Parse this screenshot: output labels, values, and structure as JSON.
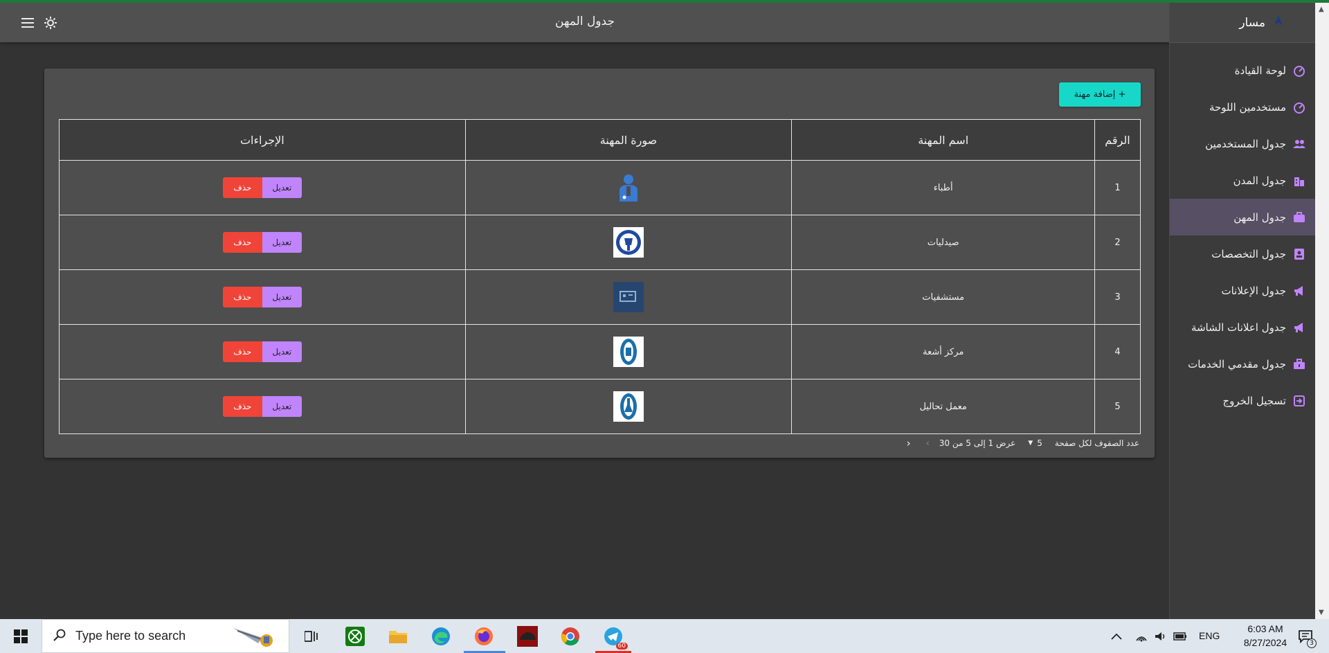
{
  "appbar": {
    "title": "جدول المهن"
  },
  "sidebar": {
    "brand": "مسار",
    "items": [
      {
        "label": "لوحة القيادة",
        "icon": "dashboard-icon",
        "active": false
      },
      {
        "label": "مستخدمين اللوحة",
        "icon": "dashboard-icon",
        "active": false
      },
      {
        "label": "جدول المستخدمين",
        "icon": "users-icon",
        "active": false
      },
      {
        "label": "جدول المدن",
        "icon": "city-icon",
        "active": false
      },
      {
        "label": "جدول المهن",
        "icon": "briefcase-icon",
        "active": true
      },
      {
        "label": "جدول التخصصات",
        "icon": "id-badge-icon",
        "active": false
      },
      {
        "label": "جدول الإعلانات",
        "icon": "megaphone-icon",
        "active": false
      },
      {
        "label": "جدول اعلانات الشاشة",
        "icon": "megaphone-icon",
        "active": false
      },
      {
        "label": "جدول مقدمي الخدمات",
        "icon": "toolbox-icon",
        "active": false
      },
      {
        "label": "تسجيل الخروج",
        "icon": "logout-icon",
        "active": false
      }
    ]
  },
  "main": {
    "add_button": "إضافة مهنة +",
    "columns": [
      "الرقم",
      "اسم المهنة",
      "صورة المهنة",
      "الإجراءات"
    ],
    "rows": [
      {
        "num": "1",
        "name": "أطباء",
        "image": "doctors-icon"
      },
      {
        "num": "2",
        "name": "صيدليات",
        "image": "pharmacy-icon"
      },
      {
        "num": "3",
        "name": "مستشفيات",
        "image": "hospital-icon"
      },
      {
        "num": "4",
        "name": "مركز أشعة",
        "image": "radiology-icon"
      },
      {
        "num": "5",
        "name": "معمل تحاليل",
        "image": "lab-icon"
      }
    ],
    "edit_label": "تعديل",
    "delete_label": "حذف",
    "pagination": {
      "rows_per_page_label": "عدد الصفوف لكل صفحة",
      "rows_per_page": "5",
      "range_text": "عرض 1 إلى 5 من 30"
    }
  },
  "taskbar": {
    "search_placeholder": "Type here to search",
    "language": "ENG",
    "time": "6:03 AM",
    "date": "8/27/2024",
    "notification_count": "3",
    "telegram_badge": "60"
  },
  "colors": {
    "accent_teal": "#17d8c8",
    "edit_purple": "#c084fc",
    "delete_red": "#f04438",
    "active_nav": "#574f63"
  }
}
